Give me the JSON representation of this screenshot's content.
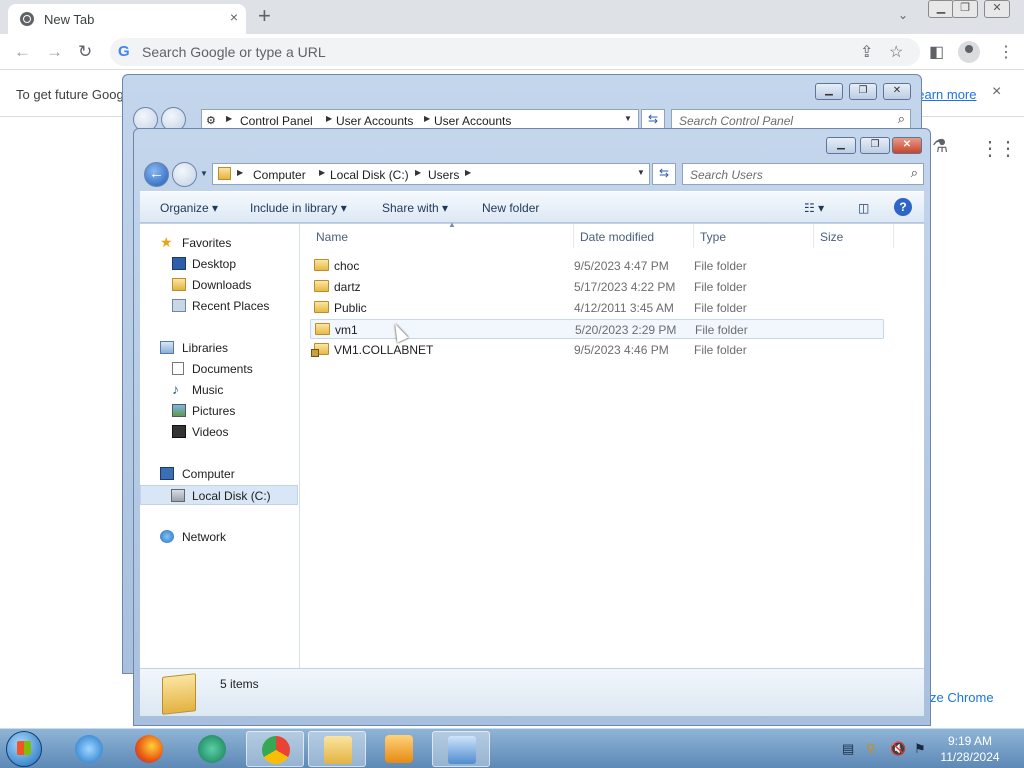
{
  "chrome": {
    "tab_title": "New Tab",
    "tab_close": "×",
    "new_tab": "+",
    "tab_search": "⌄",
    "omnibox_placeholder": "Search Google or type a URL",
    "infobar_text": "To get future Goog",
    "infobar_link": "Learn more",
    "infobar_close": "×",
    "customize_text": "ze Chrome"
  },
  "control_panel_window": {
    "breadcrumbs": [
      "Control Panel",
      "User Accounts",
      "User Accounts"
    ],
    "search_placeholder": "Search Control Panel"
  },
  "explorer": {
    "breadcrumbs": [
      "Computer",
      "Local Disk (C:)",
      "Users"
    ],
    "search_placeholder": "Search Users",
    "commands": {
      "organize": "Organize ▾",
      "include": "Include in library ▾",
      "share": "Share with ▾",
      "new_folder": "New folder"
    },
    "nav": {
      "favorites": "Favorites",
      "desktop": "Desktop",
      "downloads": "Downloads",
      "recent": "Recent Places",
      "libraries": "Libraries",
      "documents": "Documents",
      "music": "Music",
      "pictures": "Pictures",
      "videos": "Videos",
      "computer": "Computer",
      "local_disk": "Local Disk (C:)",
      "network": "Network"
    },
    "columns": {
      "name": "Name",
      "date": "Date modified",
      "type": "Type",
      "size": "Size"
    },
    "files": [
      {
        "name": "choc",
        "date": "9/5/2023 4:47 PM",
        "type": "File folder"
      },
      {
        "name": "dartz",
        "date": "5/17/2023 4:22 PM",
        "type": "File folder"
      },
      {
        "name": "Public",
        "date": "4/12/2011 3:45 AM",
        "type": "File folder"
      },
      {
        "name": "vm1",
        "date": "5/20/2023 2:29 PM",
        "type": "File folder"
      },
      {
        "name": "VM1.COLLABNET",
        "date": "9/5/2023 4:46 PM",
        "type": "File folder"
      }
    ],
    "item_count": "5 items"
  },
  "taskbar": {
    "time": "9:19 AM",
    "date": "11/28/2024"
  }
}
